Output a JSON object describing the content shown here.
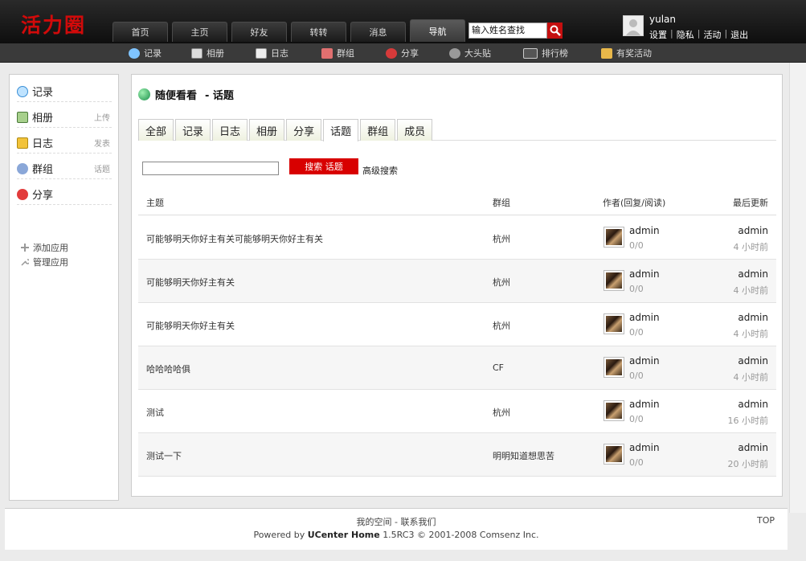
{
  "header": {
    "logo": "活力圈",
    "nav": [
      "首页",
      "主页",
      "好友",
      "转转",
      "消息",
      "导航"
    ],
    "search_value": "输入姓名查找",
    "user": {
      "name": "yulan",
      "links": [
        "设置",
        "隐私",
        "活动",
        "退出"
      ]
    }
  },
  "subnav": [
    "记录",
    "相册",
    "日志",
    "群组",
    "分享",
    "大头贴",
    "排行榜",
    "有奖活动"
  ],
  "sidebar": {
    "items": [
      {
        "label": "记录",
        "sub": ""
      },
      {
        "label": "相册",
        "sub": "上传"
      },
      {
        "label": "日志",
        "sub": "发表"
      },
      {
        "label": "群组",
        "sub": "话题"
      },
      {
        "label": "分享",
        "sub": ""
      }
    ],
    "apps": [
      "添加应用",
      "管理应用"
    ]
  },
  "main": {
    "title": "随便看看",
    "title_sub": "- 话题",
    "tabs": [
      "全部",
      "记录",
      "日志",
      "相册",
      "分享",
      "话题",
      "群组",
      "成员"
    ],
    "active_tab": 5,
    "search_button": "搜索 话题",
    "advanced_search": "高级搜索",
    "columns": {
      "subject": "主题",
      "group": "群组",
      "author": "作者(回复/阅读)",
      "last": "最后更新"
    },
    "rows": [
      {
        "subject": "可能够明天你好主有关可能够明天你好主有关",
        "group": "杭州",
        "author": "admin",
        "counts": "0/0",
        "last_author": "admin",
        "last_time": "4 小时前"
      },
      {
        "subject": "可能够明天你好主有关",
        "group": "杭州",
        "author": "admin",
        "counts": "0/0",
        "last_author": "admin",
        "last_time": "4 小时前"
      },
      {
        "subject": "可能够明天你好主有关",
        "group": "杭州",
        "author": "admin",
        "counts": "0/0",
        "last_author": "admin",
        "last_time": "4 小时前"
      },
      {
        "subject": "哈哈哈哈俱",
        "group": "CF",
        "author": "admin",
        "counts": "0/0",
        "last_author": "admin",
        "last_time": "4 小时前"
      },
      {
        "subject": "测试",
        "group": "杭州",
        "author": "admin",
        "counts": "0/0",
        "last_author": "admin",
        "last_time": "16 小时前"
      },
      {
        "subject": "测试一下",
        "group": "明明知道想思苦",
        "author": "admin",
        "counts": "0/0",
        "last_author": "admin",
        "last_time": "20 小时前"
      }
    ]
  },
  "footer": {
    "links": "我的空间 - 联系我们",
    "top": "TOP",
    "powered_prefix": "Powered by",
    "powered_product": "UCenter Home",
    "powered_suffix": "1.5RC3 © 2001-2008 Comsenz Inc."
  }
}
